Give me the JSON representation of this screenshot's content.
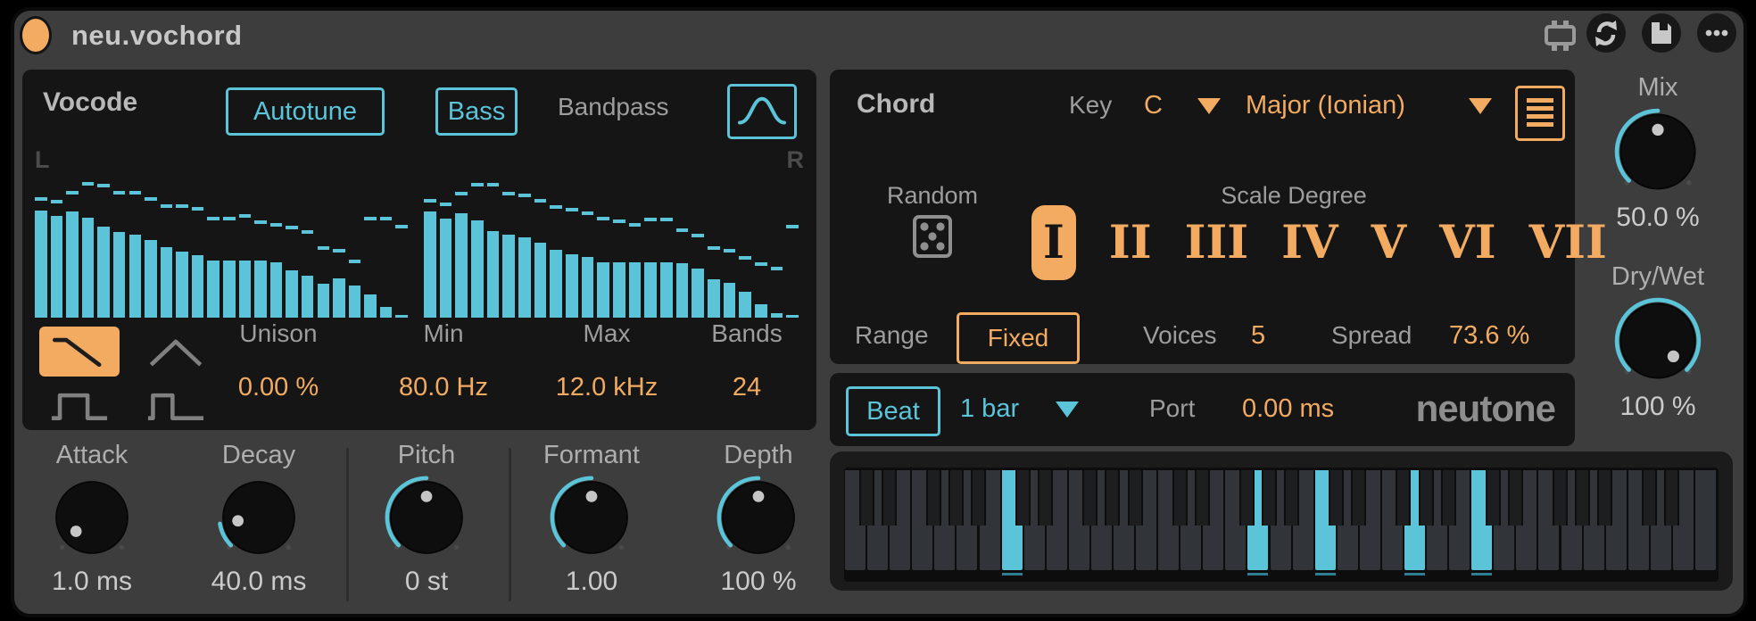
{
  "window": {
    "title": "neu.vochord"
  },
  "colors": {
    "accent_cyan": "#5bc4d9",
    "accent_orange": "#f2ab60",
    "device_gray": "#3d3d3d",
    "panel_black": "#151515"
  },
  "titlebar": {
    "icons": [
      {
        "name": "plugin-icon"
      },
      {
        "name": "refresh-icon"
      },
      {
        "name": "save-icon"
      },
      {
        "name": "more-icon"
      }
    ]
  },
  "vocode": {
    "title": "Vocode",
    "autotune_label": "Autotune",
    "bass_label": "Bass",
    "bandpass_label": "Bandpass",
    "left_label": "L",
    "right_label": "R",
    "shapes": [
      "sawtooth",
      "triangle",
      "pulse-wide",
      "pulse-narrow"
    ],
    "selected_shape": "sawtooth",
    "params": [
      {
        "label": "Unison",
        "value": "0.00 %"
      },
      {
        "label": "Min",
        "value": "80.0 Hz"
      },
      {
        "label": "Max",
        "value": "12.0 kHz"
      },
      {
        "label": "Bands",
        "value": "24"
      }
    ]
  },
  "chart_data": {
    "type": "bar",
    "title": "Vocoder band spectrum (24 bands per channel, with peak-hold dashes)",
    "ylim": [
      0,
      1
    ],
    "series": [
      {
        "name": "L",
        "values": [
          0.79,
          0.75,
          0.78,
          0.74,
          0.67,
          0.63,
          0.61,
          0.57,
          0.52,
          0.49,
          0.46,
          0.42,
          0.42,
          0.42,
          0.42,
          0.41,
          0.35,
          0.31,
          0.25,
          0.29,
          0.24,
          0.17,
          0.08,
          0.02
        ],
        "peaks": [
          0.86,
          0.84,
          0.91,
          0.98,
          0.96,
          0.91,
          0.91,
          0.86,
          0.81,
          0.81,
          0.79,
          0.72,
          0.72,
          0.74,
          0.69,
          0.67,
          0.65,
          0.62,
          0.5,
          0.48,
          0.4,
          0.72,
          0.72,
          0.66
        ]
      },
      {
        "name": "R",
        "values": [
          0.78,
          0.73,
          0.77,
          0.72,
          0.64,
          0.61,
          0.59,
          0.55,
          0.5,
          0.47,
          0.45,
          0.41,
          0.41,
          0.41,
          0.41,
          0.41,
          0.4,
          0.36,
          0.28,
          0.26,
          0.19,
          0.1,
          0.03,
          0.02
        ],
        "peaks": [
          0.85,
          0.82,
          0.9,
          0.97,
          0.97,
          0.9,
          0.89,
          0.85,
          0.8,
          0.78,
          0.76,
          0.72,
          0.7,
          0.67,
          0.71,
          0.71,
          0.63,
          0.59,
          0.5,
          0.48,
          0.43,
          0.38,
          0.35,
          0.66
        ]
      }
    ]
  },
  "envelope": {
    "knobs": [
      {
        "label": "Attack",
        "value": "1.0 ms",
        "angle": -131,
        "arc_start": null
      },
      {
        "label": "Decay",
        "value": "40.0 ms",
        "angle": -99,
        "arc_start": -135
      },
      {
        "label": "Pitch",
        "value": "0 st",
        "angle": 0,
        "arc_start": -135
      },
      {
        "label": "Formant",
        "value": "1.00",
        "angle": 0,
        "arc_start": -135
      },
      {
        "label": "Depth",
        "value": "100 %",
        "angle": 0,
        "arc_start": -135
      }
    ]
  },
  "chord": {
    "title": "Chord",
    "key_label": "Key",
    "key_value": "C",
    "scale_value": "Major (Ionian)",
    "random_label": "Random",
    "scale_degree_label": "Scale Degree",
    "degrees": [
      {
        "label": "I",
        "selected": true
      },
      {
        "label": "II",
        "selected": false
      },
      {
        "label": "III",
        "selected": false
      },
      {
        "label": "IV",
        "selected": false
      },
      {
        "label": "V",
        "selected": false
      },
      {
        "label": "VI",
        "selected": false
      },
      {
        "label": "VII",
        "selected": false
      }
    ],
    "range_label": "Range",
    "range_value": "Fixed",
    "voices_label": "Voices",
    "voices_value": "5",
    "spread_label": "Spread",
    "spread_value": "73.6 %"
  },
  "beat": {
    "beat_label": "Beat",
    "rate_value": "1 bar",
    "port_label": "Port",
    "port_value": "0.00 ms",
    "brand": "neutone"
  },
  "output": {
    "knobs": [
      {
        "label": "Mix",
        "value": "50.0 %",
        "angle": 0,
        "arc_start": -135
      },
      {
        "label": "Dry/Wet",
        "value": "100 %",
        "angle": 135,
        "arc_start": -135
      }
    ]
  },
  "keyboard": {
    "white_key_count": 39,
    "start_note": "C",
    "highlighted_white_indices": [
      7,
      18,
      21,
      25,
      28
    ],
    "highlighted_notes": [
      "C",
      "G",
      "C",
      "G",
      "C"
    ]
  }
}
